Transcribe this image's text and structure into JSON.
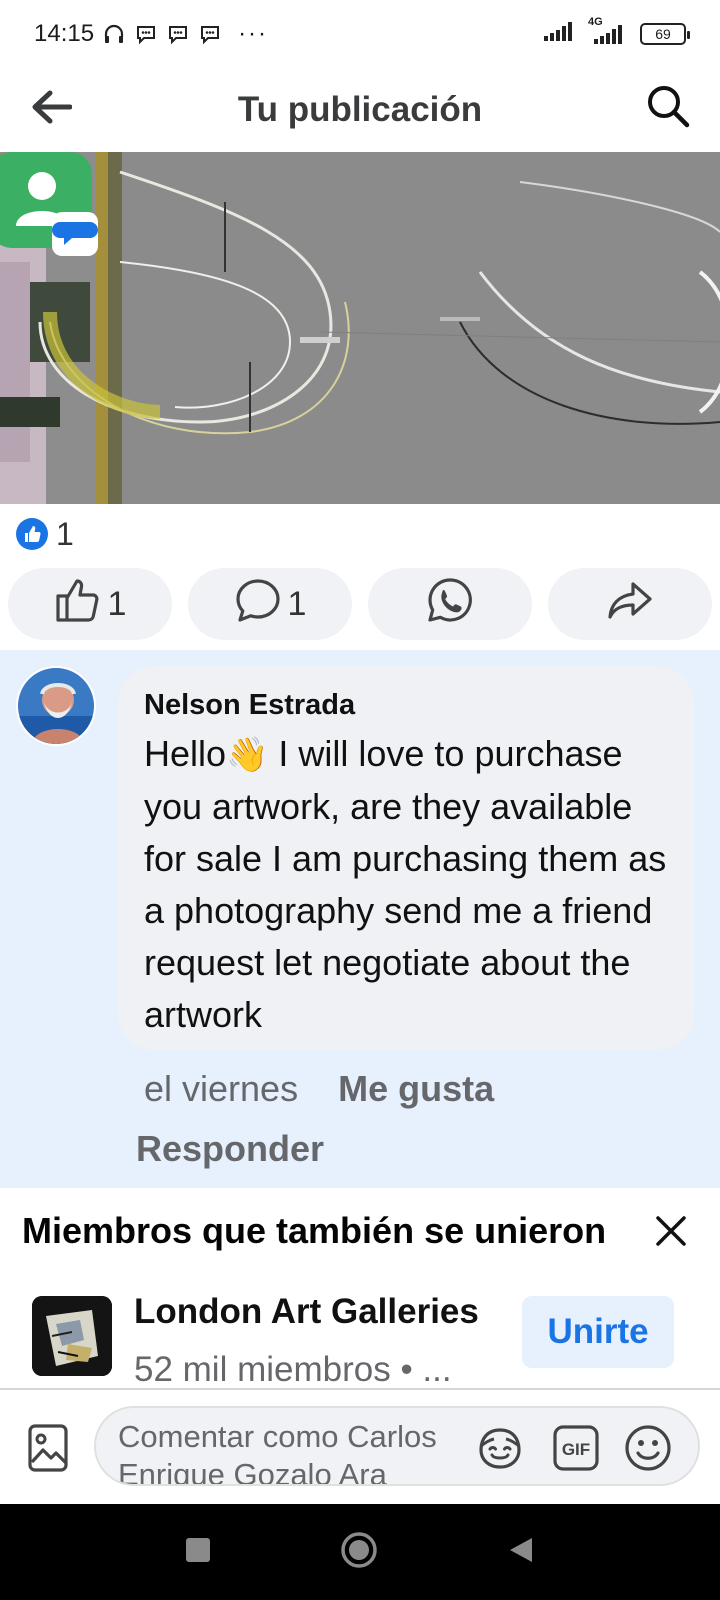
{
  "status_bar": {
    "time": "14:15",
    "more": "···",
    "network": "4G",
    "battery": "69"
  },
  "header": {
    "title": "Tu publicación"
  },
  "reactions": {
    "count": "1"
  },
  "actions": {
    "like_count": "1",
    "comment_count": "1"
  },
  "comment": {
    "author": "Nelson Estrada",
    "text_before_emoji": "Hello",
    "emoji": "👋",
    "text_after_emoji": " I will love to purchase you artwork, are they available for sale I am purchasing them as a photography send me a friend request let negotiate about the artwork",
    "time": "el viernes",
    "like_label": "Me gusta",
    "reply_label": "Responder"
  },
  "suggestion": {
    "title": "Miembros que también se unieron",
    "group_name": "London Art Galleries",
    "group_meta": "52 mil miembros • ...",
    "join_label": "Unirte"
  },
  "composer": {
    "placeholder": "Comentar como Carlos Enrique Gozalo Ara"
  },
  "colors": {
    "accent": "#1b74e4",
    "comment_highlight": "#e7f0fd",
    "bubble": "#eff1f4",
    "secondary_text": "#65676b"
  }
}
